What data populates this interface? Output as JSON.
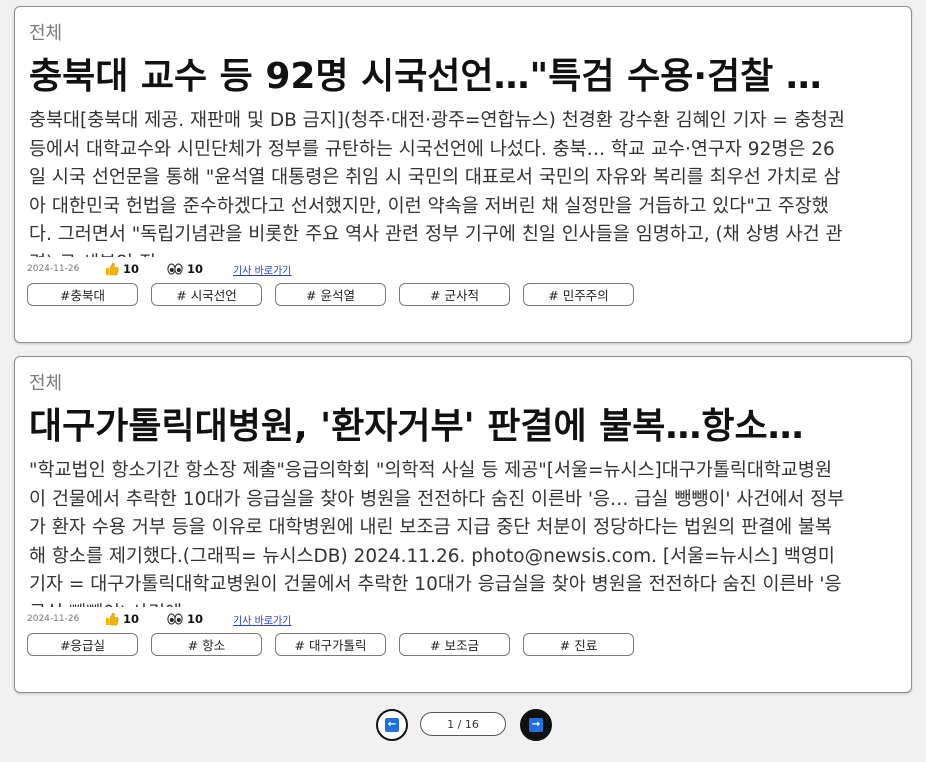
{
  "articles": [
    {
      "category": "전체",
      "headline": "충북대 교수 등 92명 시국선언…\"특검 수용·검찰 …",
      "body": "충북대[충북대 제공. 재판매 및 DB 금지](청주·대전·광주=연합뉴스) 천경환 강수환 김혜인 기자 = 충청권 등에서 대학교수와 시민단체가 정부를 규탄하는 시국선언에 나섰다. 충북… 학교 교수·연구자 92명은 26일 시국 선언문을 통해 \"윤석열 대통령은 취임 시 국민의 대표로서 국민의 자유와 복리를 최우선 가치로 삼아 대한민국 헌법을 준수하겠다고 선서했지만, 이런 약속을 저버린 채 실정만을 거듭하고 있다\"고 주장했다. 그러면서 \"독립기념관을 비롯한 주요 역사 관련 정부 기구에 친일 인사들을 임명하고, (채 상병 사건 관련) 규 세부인 직",
      "date": "2024-11-26",
      "likes": "10",
      "views": "10",
      "link_label": "기사 바로가기",
      "tags": [
        "#충북대",
        "# 시국선언",
        "# 윤석열",
        "# 군사적",
        "# 민주주의"
      ]
    },
    {
      "category": "전체",
      "headline": "대구가톨릭대병원, '환자거부' 판결에 불복…항소…",
      "body": "\"학교법인 항소기간 항소장 제출\"응급의학회 \"의학적 사실 등 제공\"[서울=뉴시스]대구가톨릭대학교병원이 건물에서 추락한 10대가 응급실을 찾아 병원을 전전하다 숨진 이른바 '응… 급실 뺑뺑이' 사건에서 정부가 환자 수용 거부 등을 이유로 대학병원에 내린 보조금 지급 중단 처분이 정당하다는 법원의 판결에 불복해 항소를 제기했다.(그래픽= 뉴시스DB) 2024.11.26. photo@newsis.com. [서울=뉴시스] 백영미 기자 = 대구가톨릭대학교병원이 건물에서 추락한 10대가 응급실을 찾아 병원을 전전하다 숨진 이른바 '응급실 뺑뺑이' 사건에",
      "date": "2024-11-26",
      "likes": "10",
      "views": "10",
      "link_label": "기사 바로가기",
      "tags": [
        "#응급실",
        "# 항소",
        "# 대구가톨릭",
        "# 보조금",
        "# 진료"
      ]
    }
  ],
  "pagination": {
    "indicator": "1 / 16",
    "prev_symbol": "←",
    "next_symbol": "→"
  },
  "icons": {
    "like": "thumbs-up-icon",
    "views": "eyes-icon",
    "prev": "arrow-left-icon",
    "next": "arrow-right-icon"
  },
  "colors": {
    "pager_accent": "#1e6fe0",
    "link": "#2a3fd1",
    "like_icon": "#f5b400"
  }
}
